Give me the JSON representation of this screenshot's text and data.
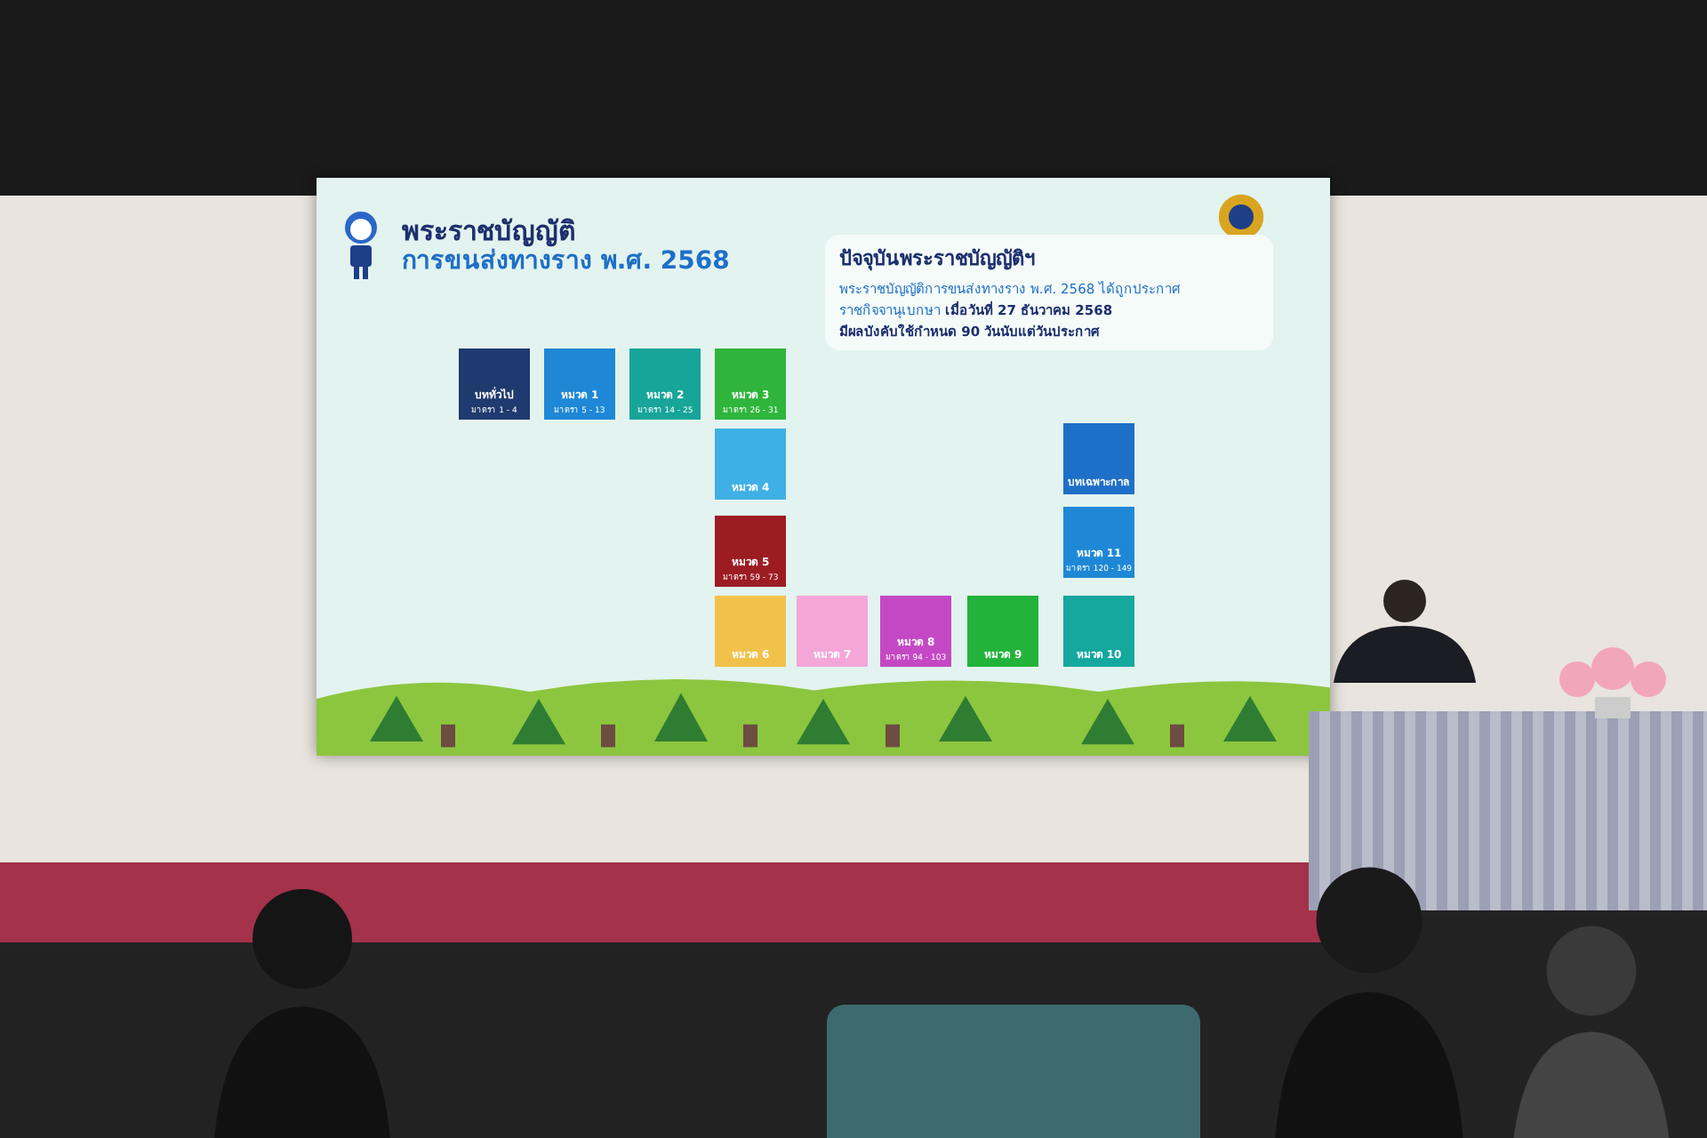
{
  "slide": {
    "title": "พระราชบัญญัติ",
    "subtitle": "การขนส่งทางราง พ.ศ. 2568",
    "notice": {
      "heading": "ปัจจุบันพระราชบัญญัติฯ",
      "lines": [
        "พระราชบัญญัติการขนส่งทางราง พ.ศ. 2568 ได้ถูกประกาศ",
        "ราชกิจจานุเบกษา **เมื่อวันที่ 27 ธันวาคม 2568**",
        "**มีผลบังคับใช้กำหนด 90 วันนับแต่วันประกาศ**"
      ]
    },
    "tiles": [
      {
        "label": "บททั่วไป",
        "range": "มาตรา 1 - 4",
        "color": "#1f3a6e"
      },
      {
        "label": "หมวด 1",
        "range": "มาตรา 5 - 13",
        "color": "#1e88d6"
      },
      {
        "label": "หมวด 2",
        "range": "มาตรา 14 - 25",
        "color": "#17a59a"
      },
      {
        "label": "หมวด 3",
        "range": "มาตรา 26 - 31",
        "color": "#2fb53c"
      },
      {
        "label": "หมวด 4",
        "color": "#3fb0e6"
      },
      {
        "label": "บทเฉพาะกาล",
        "color": "#1e6fc8"
      },
      {
        "label": "หมวด 5",
        "range": "มาตรา 59 - 73",
        "color": "#9c1c22"
      },
      {
        "label": "หมวด 11",
        "range": "มาตรา 120 - 149",
        "color": "#1e88d6"
      },
      {
        "label": "หมวด 6",
        "color": "#f2c14a"
      },
      {
        "label": "หมวด 7",
        "color": "#f4a6d8"
      },
      {
        "label": "หมวด 8",
        "range": "มาตรา 94 - 103",
        "color": "#c448c4"
      },
      {
        "label": "หมวด 9",
        "color": "#22b33a"
      },
      {
        "label": "หมวด 10",
        "color": "#14a89e"
      }
    ]
  }
}
